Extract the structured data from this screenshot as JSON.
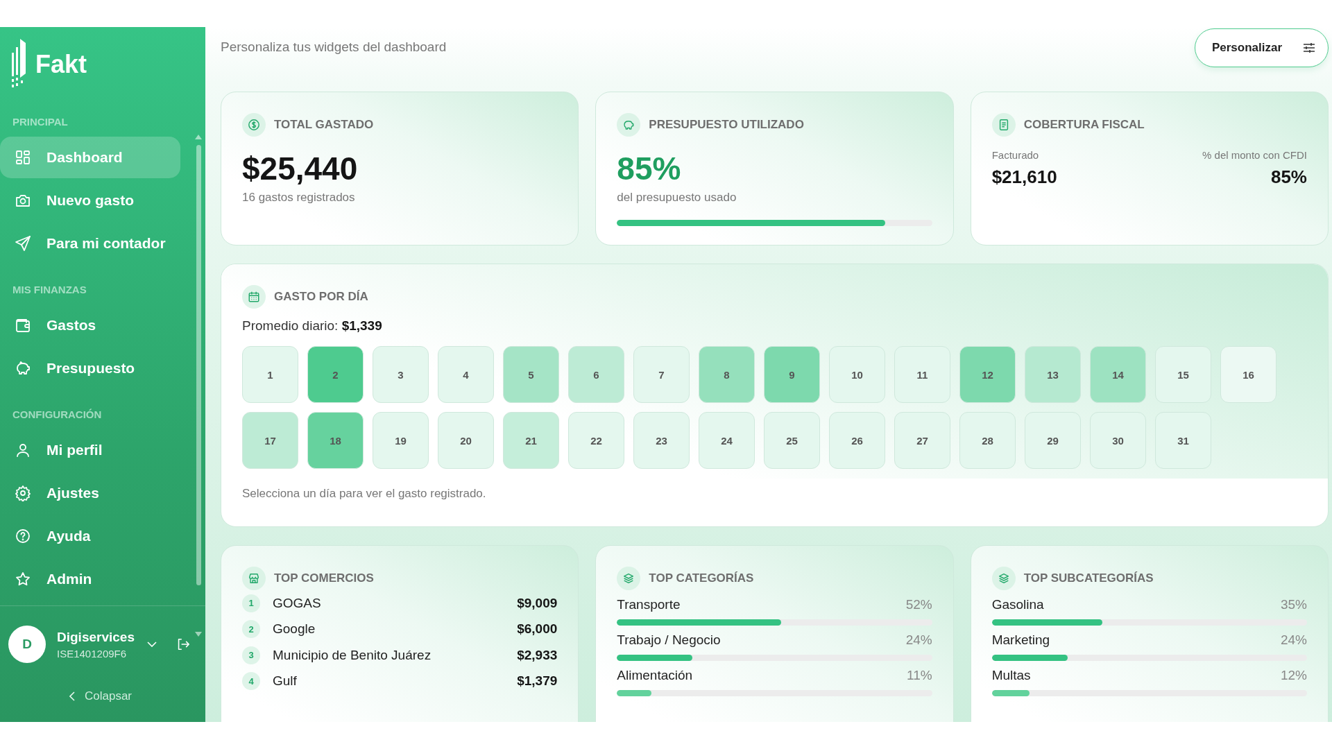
{
  "sidebar": {
    "logo": "Fakt",
    "sections": [
      {
        "label": "PRINCIPAL",
        "items": [
          {
            "label": "Dashboard",
            "selected": true
          },
          {
            "label": "Nuevo gasto",
            "selected": false
          },
          {
            "label": "Para mi contador",
            "selected": false
          }
        ]
      },
      {
        "label": "MIS FINANZAS",
        "items": [
          {
            "label": "Gastos",
            "selected": false
          },
          {
            "label": "Presupuesto",
            "selected": false
          }
        ]
      },
      {
        "label": "CONFIGURACIÓN",
        "items": [
          {
            "label": "Mi perfil",
            "selected": false
          },
          {
            "label": "Ajustes",
            "selected": false
          },
          {
            "label": "Ayuda",
            "selected": false
          },
          {
            "label": "Admin",
            "selected": false
          }
        ]
      }
    ],
    "user": {
      "avatar": "D",
      "name": "Digiservices",
      "rfc": "ISE1401209F6"
    },
    "collapse": "Colapsar"
  },
  "header": {
    "subtitle": "Personaliza tus widgets del dashboard",
    "button": "Personalizar"
  },
  "total": {
    "title": "TOTAL GASTADO",
    "amount": "$25,440",
    "caption": "16 gastos registrados"
  },
  "budget": {
    "title": "PRESUPUESTO UTILIZADO",
    "value": "85%",
    "caption": "del presupuesto usado",
    "level": 0.85
  },
  "fiscal": {
    "title": "COBERTURA FISCAL",
    "left_label": "Facturado",
    "left_value": "$21,610",
    "right_label": "% del monto con CFDI",
    "right_value": "85%"
  },
  "daily": {
    "title": "GASTO POR DÍA",
    "average_label": "Promedio diario:",
    "average_value": "$1,339",
    "hint": "Selecciona un día para ver el gasto registrado.",
    "days": [
      {
        "label": "1",
        "color": "#e4f7ee"
      },
      {
        "label": "2",
        "color": "#4ecb8f"
      },
      {
        "label": "3",
        "color": "#e4f7ee"
      },
      {
        "label": "4",
        "color": "#e4f7ee"
      },
      {
        "label": "5",
        "color": "#a5e4c6"
      },
      {
        "label": "6",
        "color": "#bdebd5"
      },
      {
        "label": "7",
        "color": "#e4f7ee"
      },
      {
        "label": "8",
        "color": "#95e0bc"
      },
      {
        "label": "9",
        "color": "#7dd9ad"
      },
      {
        "label": "10",
        "color": "#e4f7ee"
      },
      {
        "label": "11",
        "color": "#e4f7ee"
      },
      {
        "label": "12",
        "color": "#7dd9ad"
      },
      {
        "label": "13",
        "color": "#b5e9d0"
      },
      {
        "label": "14",
        "color": "#9de2c1"
      },
      {
        "label": "15",
        "color": "#e4f7ee"
      },
      {
        "label": "16",
        "color": "#ecf9f3"
      },
      {
        "label": "17",
        "color": "#bdebd5"
      },
      {
        "label": "18",
        "color": "#66d29e"
      },
      {
        "label": "19",
        "color": "#e4f7ee"
      },
      {
        "label": "20",
        "color": "#e4f7ee"
      },
      {
        "label": "21",
        "color": "#c5eeda"
      },
      {
        "label": "22",
        "color": "#e4f7ee"
      },
      {
        "label": "23",
        "color": "#e4f7ee"
      },
      {
        "label": "24",
        "color": "#e4f7ee"
      },
      {
        "label": "25",
        "color": "#e4f7ee"
      },
      {
        "label": "26",
        "color": "#e4f7ee"
      },
      {
        "label": "27",
        "color": "#e4f7ee"
      },
      {
        "label": "28",
        "color": "#e4f7ee"
      },
      {
        "label": "29",
        "color": "#e4f7ee"
      },
      {
        "label": "30",
        "color": "#e4f7ee"
      },
      {
        "label": "31",
        "color": "#e4f7ee"
      }
    ]
  },
  "merchants": {
    "title": "TOP COMERCIOS",
    "rows": [
      {
        "rank": "1",
        "name": "GOGAS",
        "amount": "$9,009"
      },
      {
        "rank": "2",
        "name": "Google",
        "amount": "$6,000"
      },
      {
        "rank": "3",
        "name": "Municipio de Benito Juárez",
        "amount": "$2,933"
      },
      {
        "rank": "4",
        "name": "Gulf",
        "amount": "$1,379"
      }
    ]
  },
  "categories": {
    "title": "TOP CATEGORÍAS",
    "rows": [
      {
        "name": "Transporte",
        "percent": "52%",
        "level": 0.52,
        "color": "#34c282"
      },
      {
        "name": "Trabajo / Negocio",
        "percent": "24%",
        "level": 0.24,
        "color": "#34c282"
      },
      {
        "name": "Alimentación",
        "percent": "11%",
        "level": 0.11,
        "color": "#62d29c"
      }
    ]
  },
  "subcategories": {
    "title": "TOP SUBCATEGORÍAS",
    "rows": [
      {
        "name": "Gasolina",
        "percent": "35%",
        "level": 0.35,
        "color": "#34c282"
      },
      {
        "name": "Marketing",
        "percent": "24%",
        "level": 0.24,
        "color": "#34c282"
      },
      {
        "name": "Multas",
        "percent": "12%",
        "level": 0.12,
        "color": "#62d29c"
      }
    ]
  }
}
